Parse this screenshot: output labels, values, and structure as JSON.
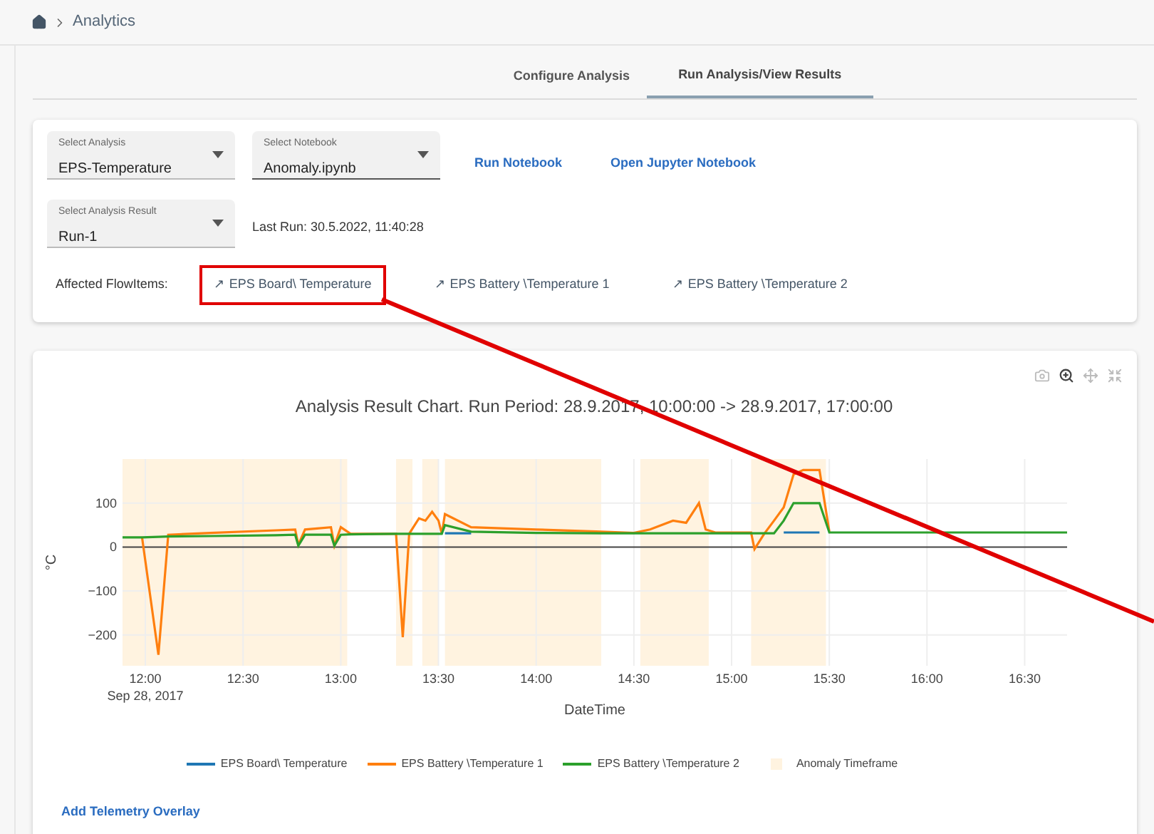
{
  "breadcrumb": {
    "items": [
      "Analytics"
    ]
  },
  "tabs": [
    {
      "label": "Configure Analysis",
      "selected": false
    },
    {
      "label": "Run Analysis/View Results",
      "selected": true
    }
  ],
  "controls": {
    "selects": [
      {
        "label": "Select Analysis",
        "value": "EPS-Temperature",
        "focused": false
      },
      {
        "label": "Select Notebook",
        "value": "Anomaly.ipynb",
        "focused": true
      }
    ],
    "actions": [
      "Run Notebook",
      "Open Jupyter Notebook"
    ],
    "result_select": {
      "label": "Select Analysis Result",
      "value": "Run-1",
      "focused": false
    },
    "last_run": "Last Run: 30.5.2022, 11:40:28",
    "affected_label": "Affected FlowItems:",
    "affected_items": [
      {
        "icon": "↗",
        "label": "EPS Board\\ Temperature",
        "highlighted": true
      },
      {
        "icon": "↗",
        "label": "EPS Battery \\Temperature 1",
        "highlighted": false
      },
      {
        "icon": "↗",
        "label": "EPS Battery \\Temperature 2",
        "highlighted": false
      }
    ]
  },
  "chart": {
    "tools": [
      {
        "kind": "camera",
        "selected": false
      },
      {
        "kind": "zoom",
        "selected": true
      },
      {
        "kind": "pan",
        "selected": false
      },
      {
        "kind": "autoscale",
        "selected": false
      }
    ],
    "x_date_label": "Sep 28, 2017",
    "anomaly_legend": {
      "name": "Anomaly Timeframe",
      "color": "#fff3e0"
    },
    "chart_data": {
      "type": "line",
      "title": "Analysis Result Chart. Run Period: 28.9.2017, 10:00:00 -> 28.9.2017, 17:00:00",
      "xlabel": "DateTime",
      "ylabel": "°C",
      "x": [
        11.883,
        11.983,
        12.067,
        12.117,
        12.333,
        12.667,
        12.767,
        12.783,
        12.817,
        12.95,
        12.967,
        13,
        13.05,
        13.283,
        13.317,
        13.35,
        13.4,
        13.433,
        13.467,
        13.5,
        13.517,
        13.533,
        13.667,
        14,
        14.333,
        14.5,
        14.583,
        14.7,
        14.767,
        14.833,
        14.867,
        14.917,
        15.1,
        15.117,
        15.167,
        15.217,
        15.267,
        15.317,
        15.367,
        15.45,
        15.5,
        16.717
      ],
      "series": [
        {
          "name": "EPS Board\\ Temperature",
          "color": "#1f77b4",
          "values": [
            null,
            null,
            null,
            null,
            null,
            null,
            null,
            null,
            null,
            null,
            null,
            null,
            null,
            null,
            null,
            null,
            null,
            null,
            null,
            null,
            null,
            31,
            31,
            null,
            null,
            null,
            null,
            null,
            null,
            null,
            null,
            null,
            null,
            null,
            null,
            null,
            33,
            33,
            33,
            33,
            null,
            null
          ]
        },
        {
          "name": "EPS Battery \\Temperature 1",
          "color": "#ff7f0e",
          "values": [
            null,
            22,
            -245,
            28,
            32,
            38,
            40,
            5,
            40,
            45,
            3,
            45,
            30,
            30,
            -205,
            30,
            65,
            60,
            80,
            60,
            30,
            75,
            45,
            40,
            35,
            32,
            40,
            60,
            55,
            100,
            40,
            33,
            33,
            -5,
            30,
            60,
            90,
            165,
            175,
            175,
            35,
            null
          ]
        },
        {
          "name": "EPS Battery \\Temperature 2",
          "color": "#2ca02c",
          "values": [
            22,
            22,
            23,
            24,
            25,
            27,
            28,
            3,
            28,
            28,
            3,
            28,
            29,
            30,
            30,
            30,
            30,
            30,
            30,
            30,
            30,
            50,
            35,
            32,
            31,
            31,
            31,
            31,
            31,
            31,
            31,
            31,
            31,
            31,
            31,
            31,
            60,
            100,
            100,
            100,
            33,
            33
          ]
        }
      ],
      "xlim": [
        11.883,
        16.717
      ],
      "ylim": [
        -270,
        200
      ],
      "grid": true,
      "xticks": [
        {
          "value": 12,
          "label": "12:00"
        },
        {
          "value": 12.5,
          "label": "12:30"
        },
        {
          "value": 13,
          "label": "13:00"
        },
        {
          "value": 13.5,
          "label": "13:30"
        },
        {
          "value": 14,
          "label": "14:00"
        },
        {
          "value": 14.5,
          "label": "14:30"
        },
        {
          "value": 15,
          "label": "15:00"
        },
        {
          "value": 15.5,
          "label": "15:30"
        },
        {
          "value": 16,
          "label": "16:00"
        },
        {
          "value": 16.5,
          "label": "16:30"
        }
      ],
      "yticks": [
        {
          "value": -200,
          "label": "−200"
        },
        {
          "value": -100,
          "label": "−100"
        },
        {
          "value": 0,
          "label": "0"
        },
        {
          "value": 100,
          "label": "100"
        }
      ],
      "bands": [
        {
          "axis": "x",
          "from": 11.883,
          "to": 13.033
        },
        {
          "axis": "x",
          "from": 13.283,
          "to": 13.367
        },
        {
          "axis": "x",
          "from": 13.417,
          "to": 13.5
        },
        {
          "axis": "x",
          "from": 13.533,
          "to": 14.333
        },
        {
          "axis": "x",
          "from": 14.533,
          "to": 14.883
        },
        {
          "axis": "x",
          "from": 15.1,
          "to": 15.483
        }
      ]
    }
  },
  "overlay_action": "Add Telemetry Overlay"
}
